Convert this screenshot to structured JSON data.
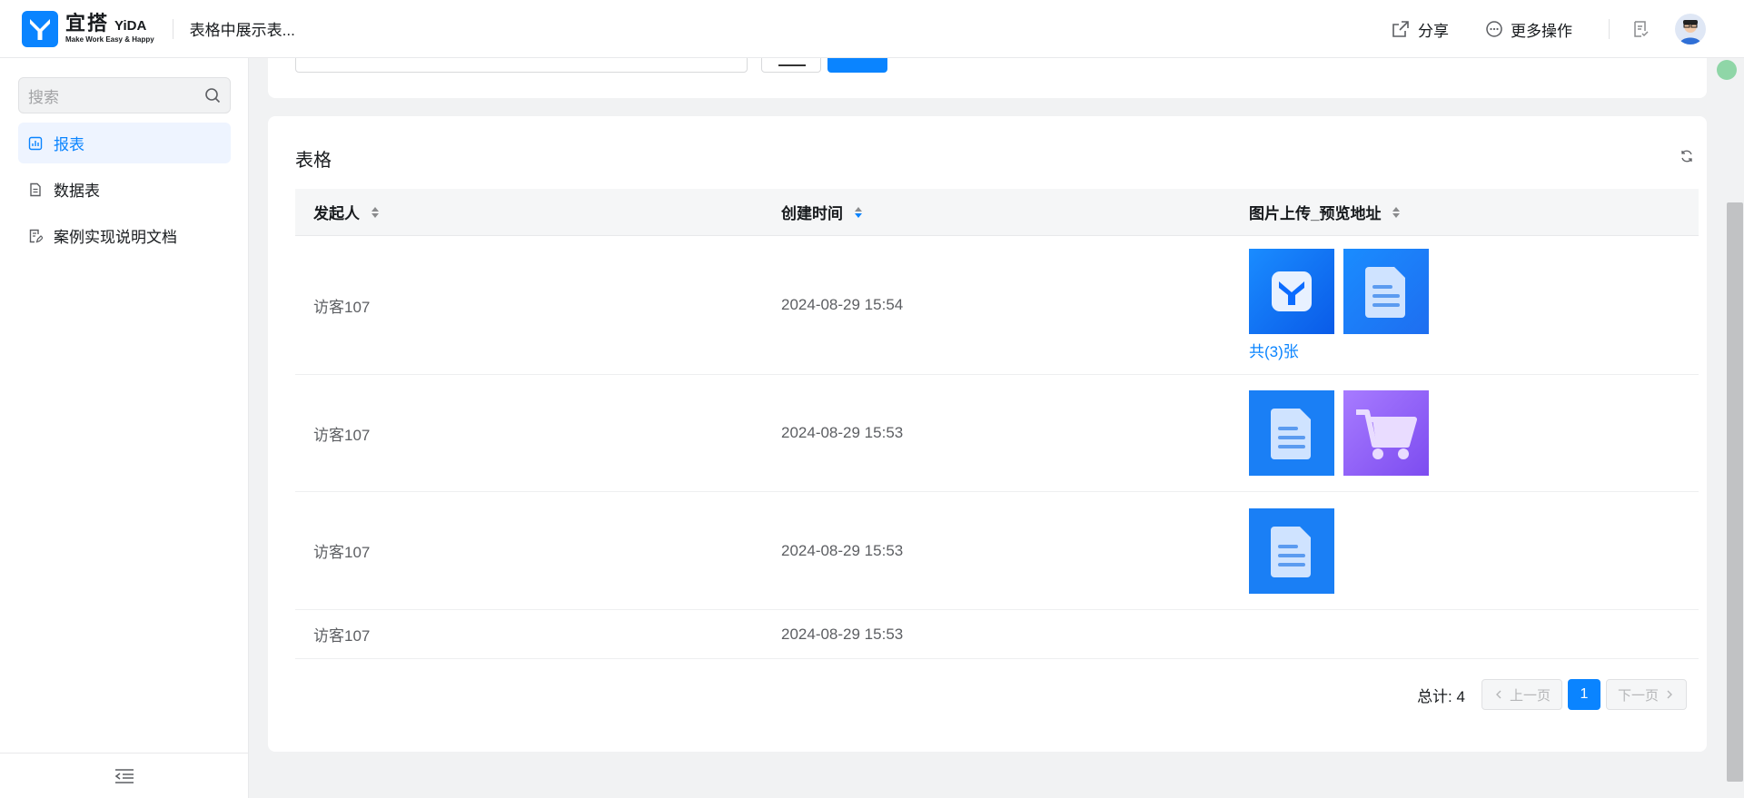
{
  "header": {
    "logo_cn": "宜搭",
    "logo_en": "YiDA",
    "logo_slogan": "Make Work Easy & Happy",
    "app_title": "表格中展示表...",
    "share_label": "分享",
    "more_label": "更多操作"
  },
  "sidebar": {
    "search_placeholder": "搜索",
    "items": [
      {
        "label": "报表",
        "icon": "chart-icon",
        "active": true
      },
      {
        "label": "数据表",
        "icon": "document-icon",
        "active": false
      },
      {
        "label": "案例实现说明文档",
        "icon": "edit-document-icon",
        "active": false
      }
    ]
  },
  "card": {
    "title": "表格"
  },
  "table": {
    "columns": [
      "发起人",
      "创建时间",
      "图片上传_预览地址"
    ],
    "rows": [
      {
        "initiator": "访客107",
        "created": "2024-08-29 15:54",
        "images": [
          "yida-logo-image",
          "document-image"
        ],
        "more_link": "共(3)张"
      },
      {
        "initiator": "访客107",
        "created": "2024-08-29 15:53",
        "images": [
          "document-image",
          "cart-image"
        ],
        "more_link": ""
      },
      {
        "initiator": "访客107",
        "created": "2024-08-29 15:53",
        "images": [
          "document-image"
        ],
        "more_link": ""
      },
      {
        "initiator": "访客107",
        "created": "2024-08-29 15:53",
        "images": [],
        "more_link": ""
      }
    ]
  },
  "pager": {
    "total": "总计: 4",
    "prev": "上一页",
    "current": "1",
    "next": "下一页"
  },
  "colors": {
    "accent": "#0a84ff",
    "active_bg": "#eef4ff"
  }
}
